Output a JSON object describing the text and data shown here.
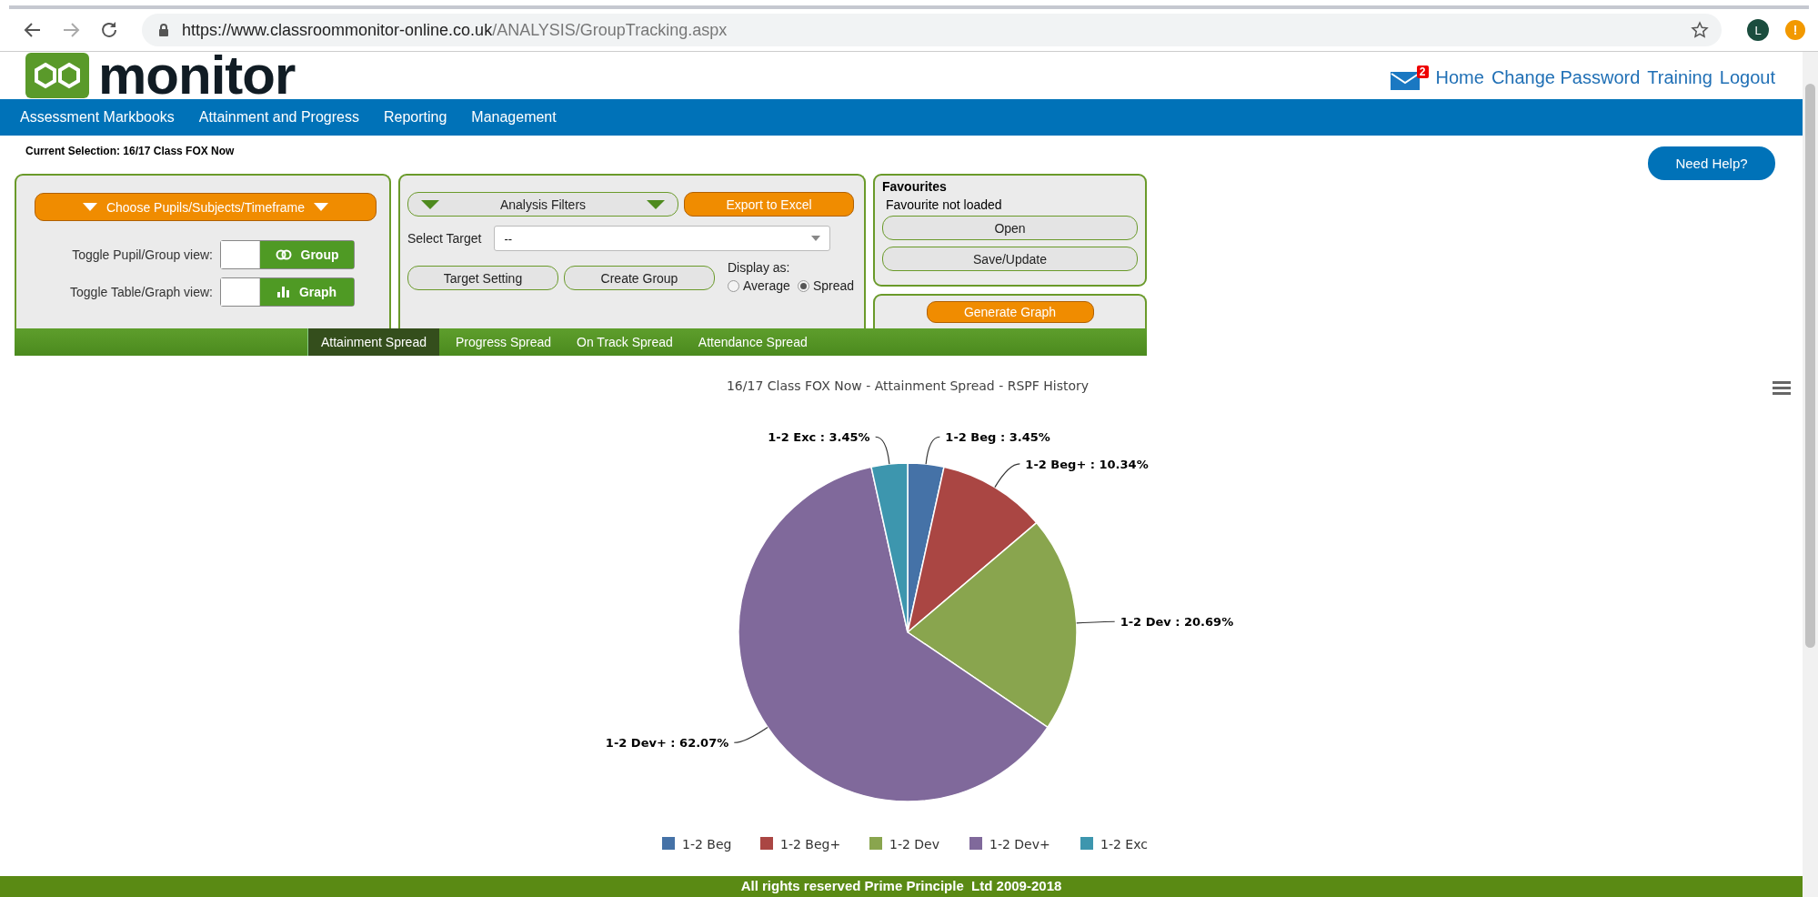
{
  "browser": {
    "url_host": "https://www.classroommonitor-online.co.uk",
    "url_path": "/ANALYSIS/GroupTracking.aspx",
    "profile_initial": "L",
    "alert": "!"
  },
  "header": {
    "logo_text": "monitor",
    "mail_badge": "2",
    "links": [
      "Home",
      "Change Password",
      "Training",
      "Logout"
    ]
  },
  "nav": {
    "items": [
      "Assessment Markbooks",
      "Attainment and Progress",
      "Reporting",
      "Management"
    ]
  },
  "current_selection": "Current Selection: 16/17 Class FOX Now",
  "help_button": "Need Help?",
  "pupils_panel": {
    "choose_button": "Choose Pupils/Subjects/Timeframe",
    "toggles": [
      {
        "label": "Toggle Pupil/Group view:",
        "value": "Group",
        "on": true
      },
      {
        "label": "Toggle Table/Graph view:",
        "value": "Graph",
        "on": true
      }
    ]
  },
  "filters_panel": {
    "filters_button": "Analysis Filters",
    "export_button": "Export to Excel",
    "target_label": "Select Target",
    "target_value": "--",
    "buttons": [
      "Target Setting",
      "Create Group"
    ],
    "display_label": "Display as:",
    "display_options": [
      {
        "label": "Average",
        "selected": false
      },
      {
        "label": "Spread",
        "selected": true
      }
    ]
  },
  "favourites": {
    "title": "Favourites",
    "status": "Favourite not loaded",
    "buttons": [
      "Open",
      "Save/Update"
    ]
  },
  "generate_button": "Generate Graph",
  "tabs": [
    {
      "label": "Attainment Spread",
      "selected": true
    },
    {
      "label": "Progress Spread",
      "selected": false
    },
    {
      "label": "On Track Spread",
      "selected": false
    },
    {
      "label": "Attendance Spread",
      "selected": false
    }
  ],
  "chart": {
    "chart_data": {
      "type": "pie",
      "title": "16/17 Class FOX Now - Attainment Spread - RSPF History",
      "categories": [
        "1-2 Beg",
        "1-2 Beg+",
        "1-2 Dev",
        "1-2 Dev+",
        "1-2 Exc"
      ],
      "values": [
        3.45,
        10.34,
        20.69,
        62.07,
        3.45
      ],
      "colors": [
        "#4572a7",
        "#aa4643",
        "#89a54e",
        "#80699b",
        "#3d96ae"
      ],
      "value_labels": [
        "1-2 Beg : 3.45%",
        "1-2 Beg+ : 10.34%",
        "1-2 Dev : 20.69%",
        "1-2 Dev+ : 62.07%",
        "1-2 Exc : 3.45%"
      ],
      "legend": "bottom"
    }
  },
  "footer": "All rights reserved Prime Principle  Ltd 2009-2018"
}
